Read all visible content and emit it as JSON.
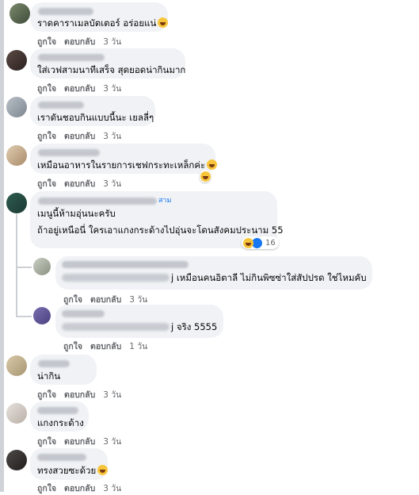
{
  "comments": [
    {
      "id": "c1",
      "text": "ราดคาราเมลบัตเตอร์ อร่อยแน่",
      "emoji": "grin-emoji",
      "like": "ถูกใจ",
      "reply": "ตอบกลับ",
      "time": "3 วัน"
    },
    {
      "id": "c2",
      "text": "ใส่เวฟสามนาทีเสร็จ สุดยอดน่ากินมาก",
      "like": "ถูกใจ",
      "reply": "ตอบกลับ",
      "time": "3 วัน"
    },
    {
      "id": "c3",
      "text": "เราดันชอบกินแบบนี้นะ เยลลี่ๆ",
      "like": "ถูกใจ",
      "reply": "ตอบกลับ",
      "time": "3 วัน"
    },
    {
      "id": "c4",
      "text": "เหมือนอาหารในรายการเชฟกระทะเหล็กค่ะ",
      "emoji": "grin-emoji",
      "like": "ถูกใจ",
      "reply": "ตอบกลับ",
      "time": "3 วัน",
      "reaction": "haha-reaction"
    },
    {
      "id": "c5",
      "badge": "สาม",
      "line1": "เมนูนี้ห้ามอุ่นนะครับ",
      "line2": "ถ้าอยู่เหนือนี่ ใครเอาแกงกระด้างไปอุ่นจะโดนสังคมประนาม 55",
      "reactions": "16"
    },
    {
      "id": "r1",
      "text": "j เหมือนคนอิตาลี ไม่กินพิซซ่าใส่สัปปรด ใช่ไหมคับ",
      "like": "ถูกใจ",
      "reply": "ตอบกลับ",
      "time": "3 วัน"
    },
    {
      "id": "r2",
      "text": "j จริง 5555",
      "like": "ถูกใจ",
      "reply": "ตอบกลับ",
      "time": "1 วัน"
    },
    {
      "id": "c6",
      "text": "น่ากิน",
      "like": "ถูกใจ",
      "reply": "ตอบกลับ",
      "time": "3 วัน"
    },
    {
      "id": "c7",
      "text": "แกงกระด้าง",
      "like": "ถูกใจ",
      "reply": "ตอบกลับ",
      "time": "3 วัน"
    },
    {
      "id": "c8",
      "text": "ทรงสวยซะด้วย",
      "emoji": "grin-emoji",
      "like": "ถูกใจ",
      "reply": "ตอบกลับ",
      "time": "3 วัน"
    }
  ],
  "colors": {
    "bubble": "#f0f2f5",
    "meta": "#65676b",
    "link": "#1877f2",
    "text": "#050505"
  }
}
